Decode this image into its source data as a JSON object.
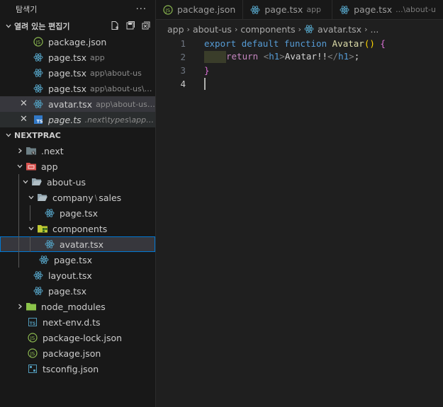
{
  "explorer": {
    "title": "탐색기",
    "more": "···",
    "open_editors": {
      "header": "열려 있는 편집기",
      "items": [
        {
          "name": "package.json",
          "desc": "",
          "icon": "json-icon"
        },
        {
          "name": "page.tsx",
          "desc": "app",
          "icon": "react-icon"
        },
        {
          "name": "page.tsx",
          "desc": "app\\about-us",
          "icon": "react-icon"
        },
        {
          "name": "page.tsx",
          "desc": "app\\about-us\\co...",
          "icon": "react-icon"
        },
        {
          "name": "avatar.tsx",
          "desc": "app\\about-us\\c...",
          "icon": "react-icon",
          "close": "✕"
        },
        {
          "name": "page.ts",
          "desc": ".next\\types\\app\\ab...",
          "icon": "ts-icon",
          "close": "✕"
        }
      ]
    },
    "project": {
      "header": "NEXTPRAC",
      "tree": [
        {
          "name": ".next",
          "chev": "›"
        },
        {
          "name": "app",
          "chev": "⌄"
        },
        {
          "name": "about-us",
          "chev": "⌄"
        },
        {
          "name": "company",
          "sep": "\\",
          "name2": "sales",
          "chev": "⌄"
        },
        {
          "name": "page.tsx"
        },
        {
          "name": "components",
          "chev": "⌄"
        },
        {
          "name": "avatar.tsx"
        },
        {
          "name": "page.tsx"
        },
        {
          "name": "layout.tsx"
        },
        {
          "name": "page.tsx"
        },
        {
          "name": "node_modules",
          "chev": "›"
        },
        {
          "name": "next-env.d.ts"
        },
        {
          "name": "package-lock.json"
        },
        {
          "name": "package.json"
        },
        {
          "name": "tsconfig.json"
        }
      ]
    }
  },
  "tabs": [
    {
      "name": "package.json",
      "desc": ""
    },
    {
      "name": "page.tsx",
      "desc": "app"
    },
    {
      "name": "page.tsx",
      "desc": "...\\about-u"
    }
  ],
  "breadcrumb": [
    "app",
    "about-us",
    "components",
    "avatar.tsx",
    "..."
  ],
  "code": {
    "line_numbers": [
      "1",
      "2",
      "3",
      "4"
    ],
    "l1": {
      "kw_export": "export",
      "kw_default": "default",
      "kw_function": "function",
      "fn": "Avatar",
      "parens": "()",
      "brace": "{"
    },
    "l2": {
      "kw_return": "return",
      "open_tag_lt": "<",
      "open_tag": "h1",
      "gt": ">",
      "text": "Avatar!!",
      "close_lt": "</",
      "close_tag": "h1",
      "close_gt": ">",
      "semi": ";"
    },
    "l3": {
      "brace": "}"
    }
  },
  "colors": {
    "react": "#519aba",
    "json": "#cbcb41",
    "ts": "#519aba"
  }
}
